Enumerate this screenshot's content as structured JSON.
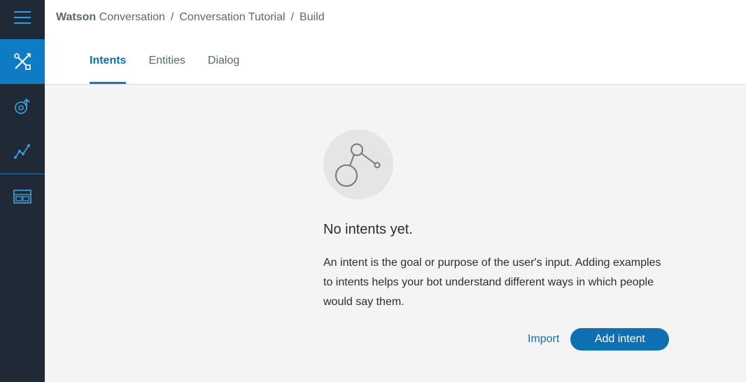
{
  "breadcrumb": {
    "brand": "Watson",
    "app": "Conversation",
    "separator": "/",
    "workspace": "Conversation Tutorial",
    "page": "Build"
  },
  "sidebar": {
    "items": [
      {
        "icon": "menu-icon"
      },
      {
        "icon": "tools-icon",
        "active": true
      },
      {
        "icon": "improve-icon"
      },
      {
        "icon": "analytics-icon"
      },
      {
        "icon": "workspaces-icon"
      }
    ]
  },
  "tabs": [
    {
      "label": "Intents",
      "active": true
    },
    {
      "label": "Entities"
    },
    {
      "label": "Dialog"
    }
  ],
  "empty_state": {
    "icon": "intent-graph-icon",
    "title": "No intents yet.",
    "description": "An intent is the goal or purpose of the user's input. Adding examples to intents helps your bot understand different ways in which people would say them.",
    "import_label": "Import",
    "add_label": "Add intent"
  },
  "colors": {
    "sidebar": "#1f2a36",
    "accent": "#0f7bc4",
    "link": "#0f6fb3",
    "background": "#f4f4f4"
  }
}
